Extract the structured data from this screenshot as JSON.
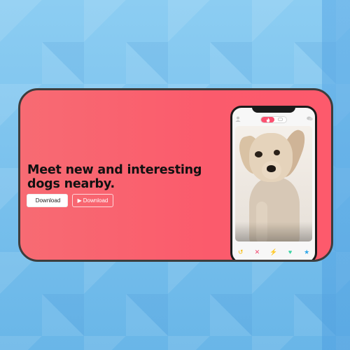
{
  "hero": {
    "headline": "Meet new and interesting dogs nearby.",
    "apple_button": {
      "icon": "apple-icon",
      "glyph": "",
      "label": "Download"
    },
    "play_button": {
      "icon": "play-icon",
      "glyph": "▶",
      "label": "Download"
    }
  },
  "phone": {
    "topbar": {
      "left_icon": "person-icon",
      "toggle_on_icon": "flame-icon",
      "toggle_off_icon": "chat-icon",
      "right_icon": "chat-bubbles-icon"
    },
    "actions": [
      {
        "name": "rewind-icon",
        "glyph": "↺",
        "color": "#f5b800"
      },
      {
        "name": "nope-icon",
        "glyph": "✕",
        "color": "#f0426b"
      },
      {
        "name": "boost-icon",
        "glyph": "⚡",
        "color": "#b25cf5"
      },
      {
        "name": "like-icon",
        "glyph": "♥",
        "color": "#3ad3a3"
      },
      {
        "name": "superlike-icon",
        "glyph": "★",
        "color": "#2ea6e8"
      }
    ]
  },
  "colors": {
    "card_gradient_start": "#f76b73",
    "card_gradient_end": "#fd5a6c",
    "accent": "#fb5070"
  }
}
